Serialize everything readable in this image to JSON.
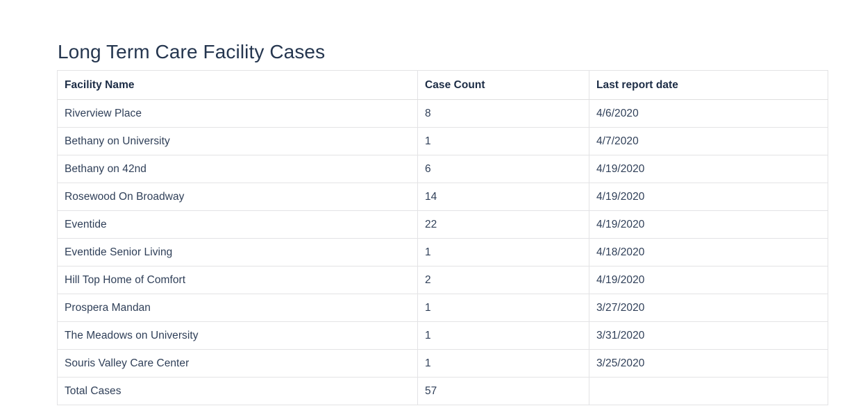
{
  "page": {
    "title": "Long Term Care Facility Cases",
    "background_color": "#ffffff",
    "title_color": "#25364f",
    "header_text_color": "#1c2c45",
    "body_text_color": "#2f3f58",
    "border_color": "#e3e3e5"
  },
  "table": {
    "columns": [
      {
        "key": "facility",
        "label": "Facility Name"
      },
      {
        "key": "count",
        "label": "Case Count"
      },
      {
        "key": "date",
        "label": "Last report date"
      }
    ],
    "rows": [
      {
        "facility": "Riverview Place",
        "count": "8",
        "date": "4/6/2020"
      },
      {
        "facility": "Bethany on University",
        "count": "1",
        "date": "4/7/2020"
      },
      {
        "facility": "Bethany on 42nd",
        "count": "6",
        "date": "4/19/2020"
      },
      {
        "facility": "Rosewood On Broadway",
        "count": "14",
        "date": "4/19/2020"
      },
      {
        "facility": "Eventide",
        "count": "22",
        "date": "4/19/2020"
      },
      {
        "facility": "Eventide Senior Living",
        "count": "1",
        "date": "4/18/2020"
      },
      {
        "facility": "Hill Top Home of Comfort",
        "count": "2",
        "date": "4/19/2020"
      },
      {
        "facility": "Prospera Mandan",
        "count": "1",
        "date": "3/27/2020"
      },
      {
        "facility": "The Meadows on University",
        "count": "1",
        "date": "3/31/2020"
      },
      {
        "facility": "Souris Valley Care Center",
        "count": "1",
        "date": "3/25/2020"
      },
      {
        "facility": "Total Cases",
        "count": "57",
        "date": ""
      }
    ]
  }
}
